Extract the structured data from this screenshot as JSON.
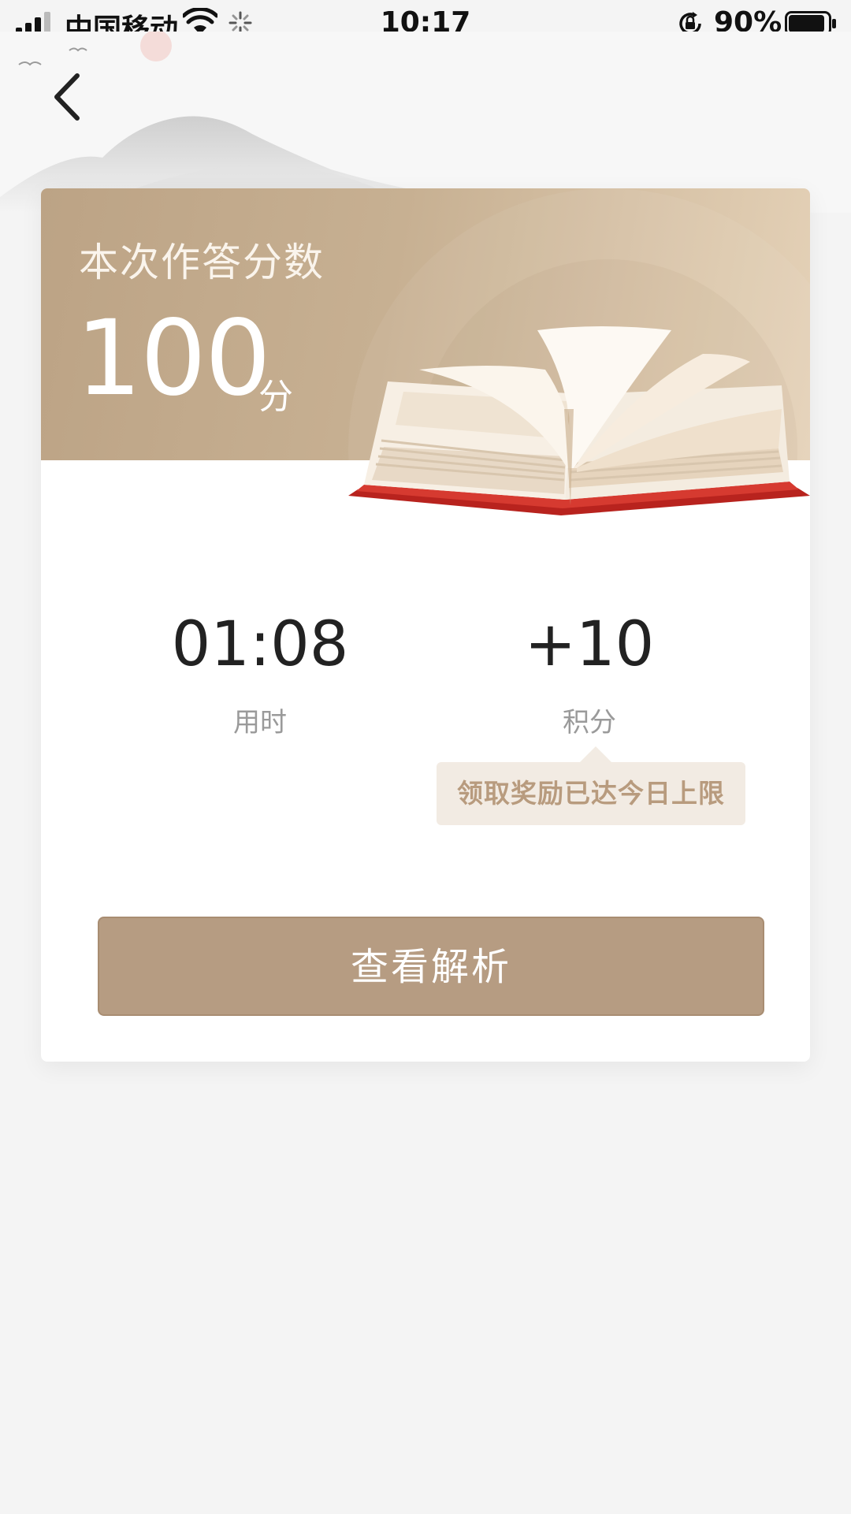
{
  "status_bar": {
    "carrier": "中国移动",
    "time": "10:17",
    "battery_percent": "90%",
    "battery_level": 0.9,
    "icons": [
      "signal-icon",
      "wifi-icon",
      "loading-spinner-icon",
      "rotation-lock-icon",
      "battery-icon"
    ]
  },
  "header": {
    "back_icon": "chevron-left-icon"
  },
  "result_card": {
    "score_label": "本次作答分数",
    "score_value": "100",
    "score_unit": "分",
    "illustration": "open-book",
    "time_used_value": "01:08",
    "time_used_label": "用时",
    "points_value": "+10",
    "points_label": "积分",
    "reward_limit_notice": "领取奖励已达今日上限",
    "view_analysis_label": "查看解析"
  },
  "colors": {
    "accent": "#b69c82",
    "header_gradient_start": "#bca385",
    "header_gradient_end": "#e5d2b8",
    "tooltip_bg": "#f2ebe3",
    "tooltip_text": "#b89b7e",
    "book_cover_red": "#b8231e"
  }
}
